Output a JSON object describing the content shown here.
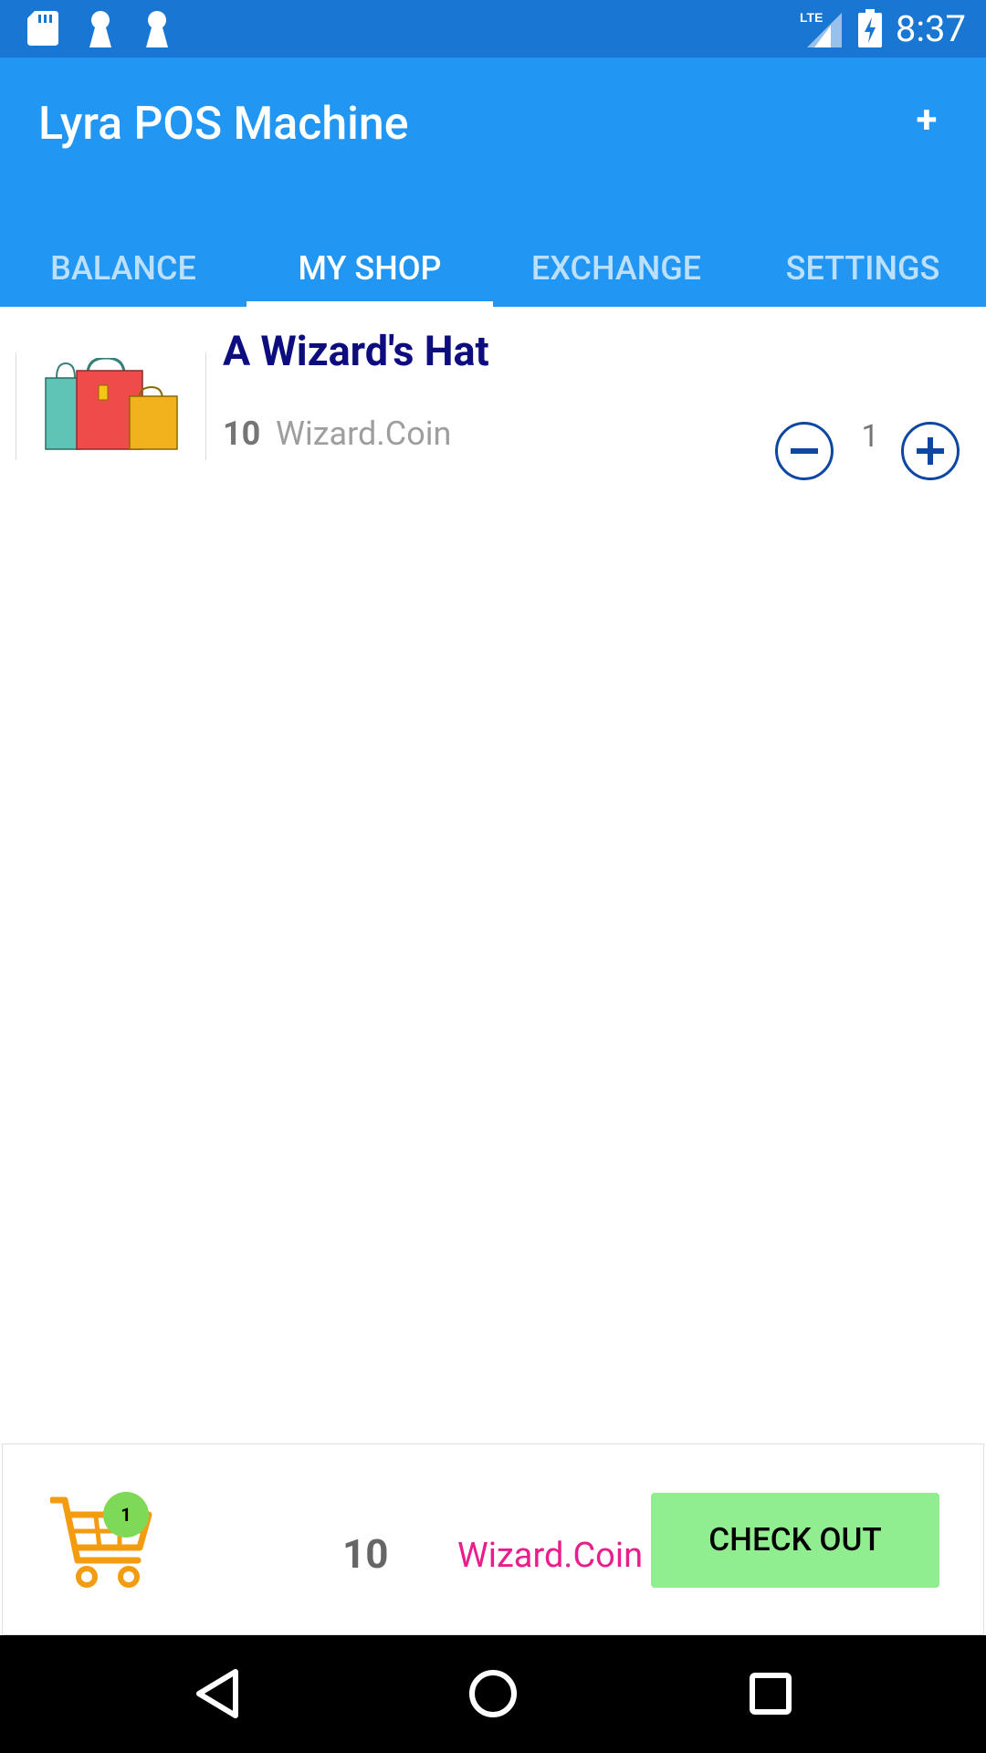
{
  "status_bar": {
    "time": "8:37",
    "network_label": "LTE",
    "icons": [
      "sd-card-icon",
      "keyhole-icon",
      "keyhole-icon",
      "lte-signal-icon",
      "battery-charging-icon"
    ]
  },
  "app_bar": {
    "title": "Lyra POS Machine",
    "add_label": "+"
  },
  "tabs": [
    {
      "label": "BALANCE",
      "active": false
    },
    {
      "label": "MY SHOP",
      "active": true
    },
    {
      "label": "EXCHANGE",
      "active": false
    },
    {
      "label": "SETTINGS",
      "active": false
    }
  ],
  "items": [
    {
      "name": "A Wizard's Hat",
      "price": "10",
      "currency": "Wizard.Coin",
      "quantity": "1",
      "image_icon": "shopping-bags-icon"
    }
  ],
  "cart": {
    "badge_count": "1",
    "total": "10",
    "currency": "Wizard.Coin",
    "checkout_label": "CHECK OUT"
  },
  "colors": {
    "status_bar": "#1976D2",
    "app_bar": "#2196F3",
    "item_title": "#0D0D80",
    "stepper": "#0D47A1",
    "checkout_bg": "#90EE90",
    "currency_accent": "#E91E8C",
    "cart_icon": "#F39C12"
  },
  "nav_bar": {
    "icons": [
      "back-icon",
      "home-icon",
      "recents-icon"
    ]
  }
}
